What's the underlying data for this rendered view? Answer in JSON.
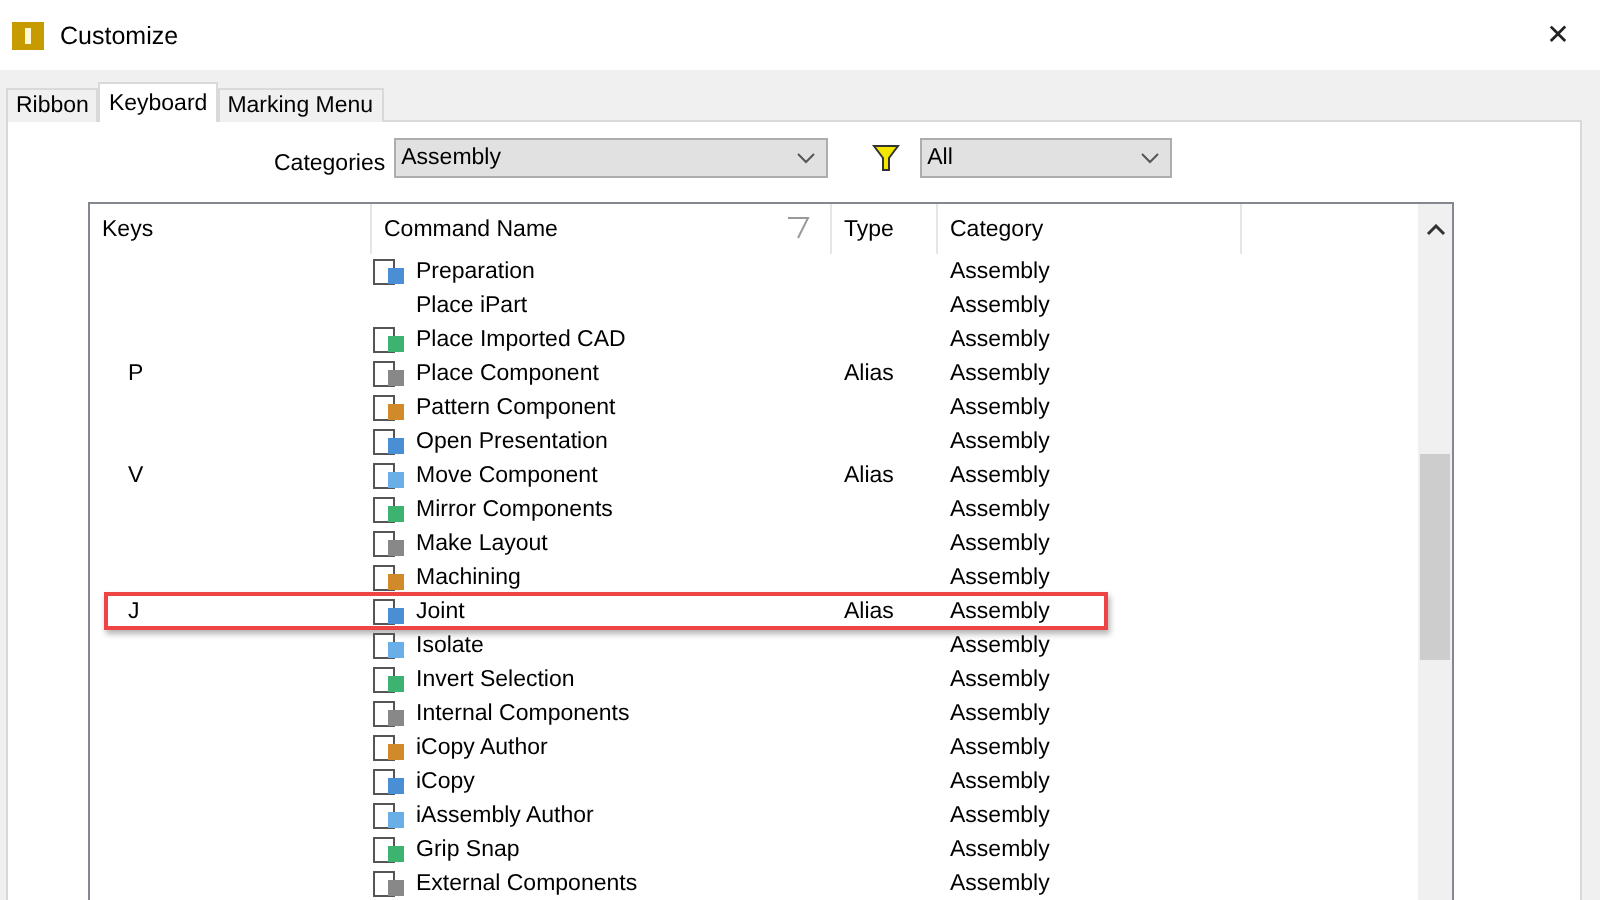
{
  "window": {
    "title": "Customize",
    "close": "✕"
  },
  "tabs": [
    {
      "label": "Ribbon",
      "selected": false
    },
    {
      "label": "Keyboard",
      "selected": true
    },
    {
      "label": "Marking Menu",
      "selected": false
    }
  ],
  "categories": {
    "label": "Categories",
    "value": "Assembly"
  },
  "filter": {
    "value": "All"
  },
  "table": {
    "columns": [
      "Keys",
      "Command Name",
      "Type",
      "Category"
    ],
    "rows": [
      {
        "keys": "",
        "command": "Preparation",
        "icon": true,
        "type": "",
        "category": "Assembly",
        "highlighted": false
      },
      {
        "keys": "",
        "command": "Place iPart",
        "icon": false,
        "type": "",
        "category": "Assembly",
        "highlighted": false
      },
      {
        "keys": "",
        "command": "Place Imported CAD",
        "icon": true,
        "type": "",
        "category": "Assembly",
        "highlighted": false
      },
      {
        "keys": "P",
        "command": "Place Component",
        "icon": true,
        "type": "Alias",
        "category": "Assembly",
        "highlighted": false
      },
      {
        "keys": "",
        "command": "Pattern Component",
        "icon": true,
        "type": "",
        "category": "Assembly",
        "highlighted": false
      },
      {
        "keys": "",
        "command": "Open Presentation",
        "icon": true,
        "type": "",
        "category": "Assembly",
        "highlighted": false
      },
      {
        "keys": "V",
        "command": "Move Component",
        "icon": true,
        "type": "Alias",
        "category": "Assembly",
        "highlighted": false
      },
      {
        "keys": "",
        "command": "Mirror Components",
        "icon": true,
        "type": "",
        "category": "Assembly",
        "highlighted": false
      },
      {
        "keys": "",
        "command": "Make Layout",
        "icon": true,
        "type": "",
        "category": "Assembly",
        "highlighted": false
      },
      {
        "keys": "",
        "command": "Machining",
        "icon": true,
        "type": "",
        "category": "Assembly",
        "highlighted": false
      },
      {
        "keys": "J",
        "command": "Joint",
        "icon": true,
        "type": "Alias",
        "category": "Assembly",
        "highlighted": true
      },
      {
        "keys": "",
        "command": "Isolate",
        "icon": true,
        "type": "",
        "category": "Assembly",
        "highlighted": false
      },
      {
        "keys": "",
        "command": "Invert Selection",
        "icon": true,
        "type": "",
        "category": "Assembly",
        "highlighted": false
      },
      {
        "keys": "",
        "command": "Internal Components",
        "icon": true,
        "type": "",
        "category": "Assembly",
        "highlighted": false
      },
      {
        "keys": "",
        "command": "iCopy Author",
        "icon": true,
        "type": "",
        "category": "Assembly",
        "highlighted": false
      },
      {
        "keys": "",
        "command": "iCopy",
        "icon": true,
        "type": "",
        "category": "Assembly",
        "highlighted": false
      },
      {
        "keys": "",
        "command": "iAssembly Author",
        "icon": true,
        "type": "",
        "category": "Assembly",
        "highlighted": false
      },
      {
        "keys": "",
        "command": "Grip Snap",
        "icon": true,
        "type": "",
        "category": "Assembly",
        "highlighted": false
      },
      {
        "keys": "",
        "command": "External Components",
        "icon": true,
        "type": "",
        "category": "Assembly",
        "highlighted": false
      }
    ]
  }
}
